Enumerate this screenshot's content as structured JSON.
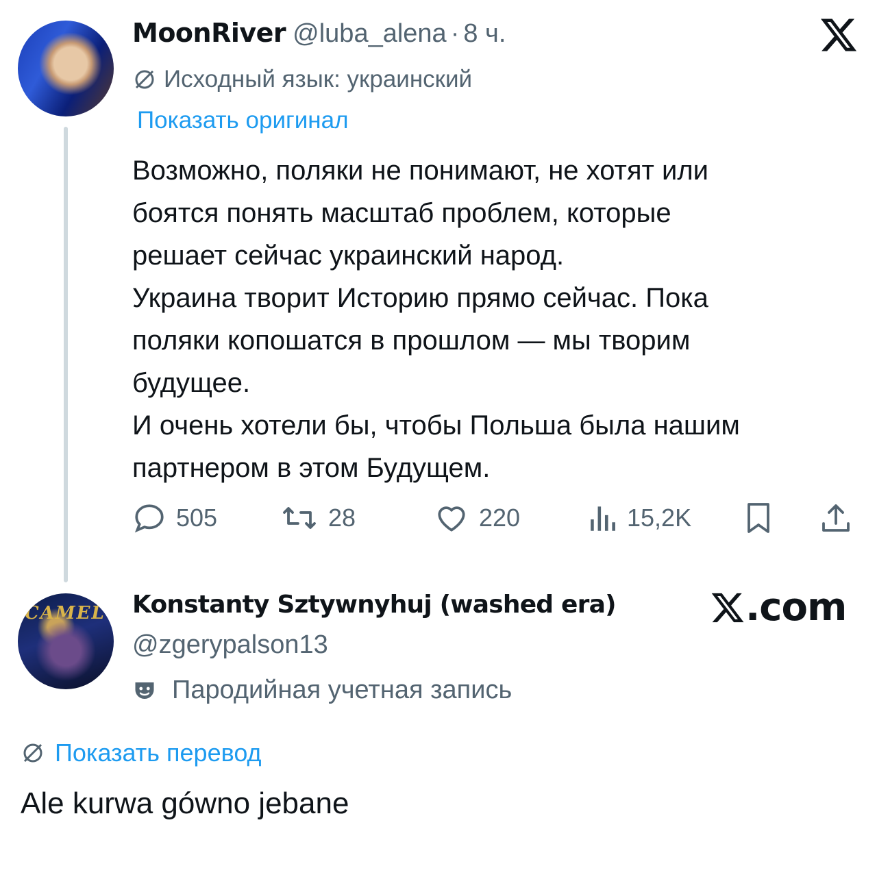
{
  "tweet": {
    "author": {
      "display_name": "MoonRiver",
      "handle": "@luba_alena",
      "separator": "·",
      "time": "8 ч."
    },
    "source_language": "Исходный язык: украинский",
    "show_original": "Показать оригинал",
    "body": [
      "Возможно, поляки не понимают, не хотят или",
      "боятся понять масштаб проблем, которые",
      "решает сейчас украинский народ.",
      "Украина творит Историю прямо сейчас. Пока",
      "поляки копошатся в прошлом — мы творим",
      "будущее.",
      "И очень хотели бы, чтобы Польша была нашим",
      "партнером в этом Будущем."
    ],
    "stats": {
      "replies": "505",
      "reposts": "28",
      "likes": "220",
      "views": "15,2K"
    }
  },
  "reply": {
    "author": {
      "display_name": "Konstanty Sztywnyhuj (washed era)",
      "handle": "@zgerypalson13",
      "badge": "Пародийная учетная запись",
      "avatar_text": "CAMEL"
    },
    "site": ".com",
    "show_translation": "Показать перевод",
    "body": "Ale kurwa gówno jebane"
  },
  "colors": {
    "text": "#0f1419",
    "secondary": "#536471",
    "link": "#1d9bf0",
    "thread_line": "#cfd9de"
  },
  "icons": [
    "x-logo-icon",
    "translate-icon",
    "reply-icon",
    "repost-icon",
    "like-icon",
    "views-icon",
    "bookmark-icon",
    "share-icon",
    "parody-mask-icon"
  ]
}
